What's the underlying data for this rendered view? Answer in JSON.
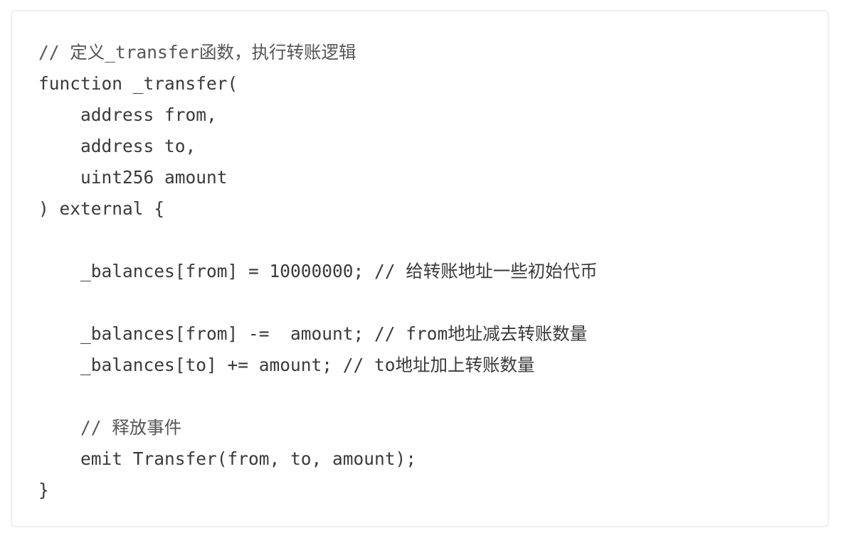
{
  "code": {
    "language": "solidity",
    "lines": [
      {
        "text": "// 定义_transfer函数，执行转账逻辑",
        "kind": "comment"
      },
      {
        "text": "function _transfer(",
        "kind": "code"
      },
      {
        "text": "    address from,",
        "kind": "code"
      },
      {
        "text": "    address to,",
        "kind": "code"
      },
      {
        "text": "    uint256 amount",
        "kind": "code"
      },
      {
        "text": ") external {",
        "kind": "code"
      },
      {
        "text": "",
        "kind": "blank"
      },
      {
        "text": "    _balances[from] = 10000000; // 给转账地址一些初始代币",
        "kind": "code"
      },
      {
        "text": "",
        "kind": "blank"
      },
      {
        "text": "    _balances[from] -=  amount; // from地址减去转账数量",
        "kind": "code"
      },
      {
        "text": "    _balances[to] += amount; // to地址加上转账数量",
        "kind": "code"
      },
      {
        "text": "",
        "kind": "blank"
      },
      {
        "text": "    // 释放事件",
        "kind": "comment"
      },
      {
        "text": "    emit Transfer(from, to, amount);",
        "kind": "code"
      },
      {
        "text": "}",
        "kind": "code"
      }
    ]
  }
}
